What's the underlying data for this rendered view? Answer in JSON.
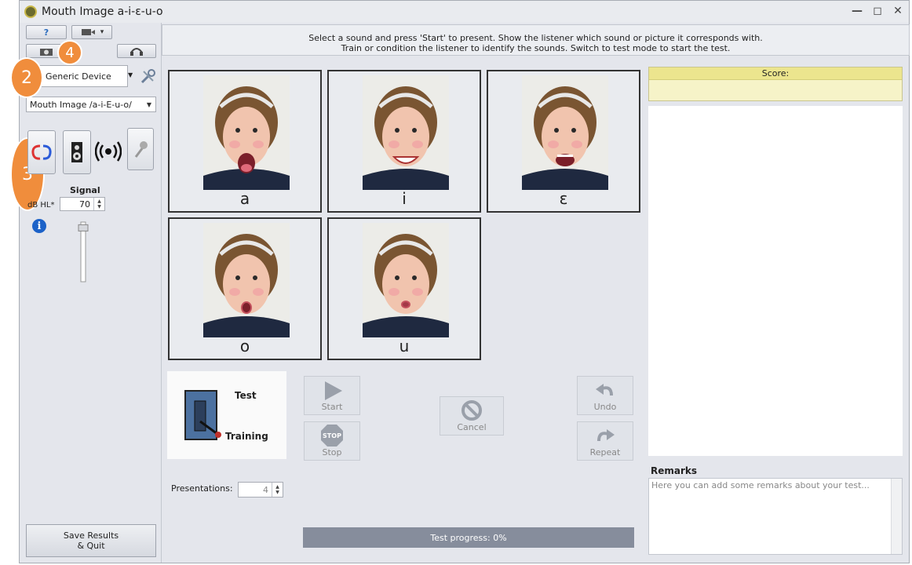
{
  "window": {
    "title": "Mouth Image a-i-ɛ-u-o"
  },
  "toolbar": {
    "help_glyph": "?",
    "camera_glyph": "■",
    "dropdown_glyph": "▾"
  },
  "badges": [
    "2",
    "3",
    "4"
  ],
  "device": {
    "selected": "Generic Device"
  },
  "test_select": {
    "selected": "Mouth Image /a-i-E-u-o/"
  },
  "signal": {
    "title": "Signal",
    "unit_label": "dB HL*",
    "value": "70",
    "slider_level": 0.95
  },
  "save": {
    "label": "Save Results\n& Quit"
  },
  "instructions": {
    "text": "Select a sound and press 'Start' to present. Show the listener which sound or picture it corresponds with.\nTrain or condition the listener to identify the sounds. Switch to test mode to start the test."
  },
  "tiles": [
    {
      "label": "a",
      "mouth": "open-wide"
    },
    {
      "label": "i",
      "mouth": "smile"
    },
    {
      "label": "ɛ",
      "mouth": "open"
    },
    {
      "label": "o",
      "mouth": "round"
    },
    {
      "label": "u",
      "mouth": "pucker"
    }
  ],
  "mode": {
    "test_label": "Test",
    "training_label": "Training"
  },
  "actions": {
    "start": "Start",
    "stop": "Stop",
    "stop_sign": "STOP",
    "cancel": "Cancel",
    "undo": "Undo",
    "repeat": "Repeat"
  },
  "presentations": {
    "label": "Presentations:",
    "value": "4"
  },
  "progress": {
    "text": "Test progress: 0%"
  },
  "score": {
    "title": "Score:"
  },
  "remarks": {
    "title": "Remarks",
    "placeholder": "Here you can add some remarks about your test..."
  },
  "colors": {
    "accent_badge": "#f08d3c",
    "score_bar": "#ece58e",
    "progress_bar": "#868d9c"
  }
}
